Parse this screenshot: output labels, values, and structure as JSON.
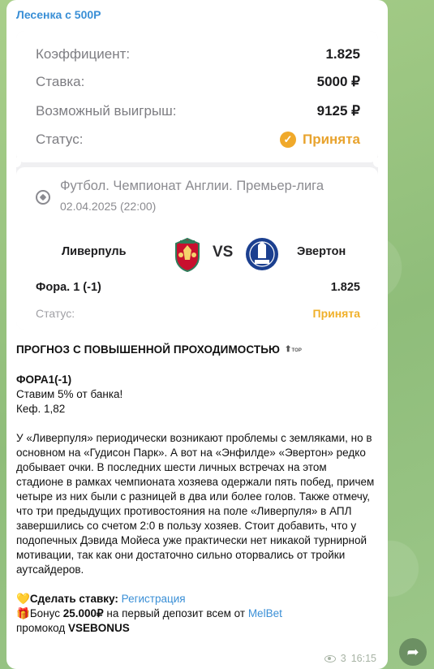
{
  "channel": {
    "name": "Лесенка с 500Р"
  },
  "ticket": {
    "rows": [
      {
        "label": "Коэффициент:",
        "value": "1.825"
      },
      {
        "label": "Ставка:",
        "value": "5000 ₽"
      },
      {
        "label": "Возможный выигрыш:",
        "value": "9125 ₽"
      }
    ],
    "status_label": "Статус:",
    "status_value": "Принята"
  },
  "event": {
    "league": "Футбол. Чемпионат Англии. Премьер-лига",
    "date": "02.04.2025 (22:00)",
    "home": "Ливерпуль",
    "vs": "VS",
    "away": "Эвертон",
    "bet": "Фора. 1 (-1)",
    "odds": "1.825",
    "status_label": "Статус:",
    "status_value": "Принята"
  },
  "post": {
    "headline": "ПРОГНОЗ С ПОВЫШЕННОЙ ПРОХОДИМОСТЬЮ",
    "top_badge": "TOP",
    "pick": "ФОРА1(-1)",
    "stake_note": "Ставим 5% от банка!",
    "coef": "Кеф. 1,82",
    "body": "У «Ливерпуля» периодически возникают проблемы с земляками, но в основном на «Гудисон Парк». А вот на «Энфилде» «Эвертон» редко добывает очки. В последних шести личных встречах на этом стадионе в рамках чемпионата хозяева одержали пять побед, причем четыре из них были с разницей в два или более голов. Также отмечу, что три предыдущих противостояния на поле «Ливерпуля» в АПЛ завершились со счетом 2:0 в пользу хозяев. Стоит добавить, что у подопечных Дэвида Мойеса уже практически нет никакой турнирной мотивации, так как они достаточно сильно оторвались от тройки аутсайдеров.",
    "cta_label": "Сделать ставку:",
    "cta_link": "Регистрация",
    "bonus_prefix": "Бонус",
    "bonus_amount": "25.000₽",
    "bonus_mid": "на первый депозит всем от",
    "bonus_brand": "MelBet",
    "promo_label": "промокод",
    "promo_code": "VSEBONUS"
  },
  "meta": {
    "views": "3",
    "time": "16:15"
  },
  "colors": {
    "accent": "#3a8fd6",
    "status": "#e8a32e",
    "background": "#9fc686"
  }
}
